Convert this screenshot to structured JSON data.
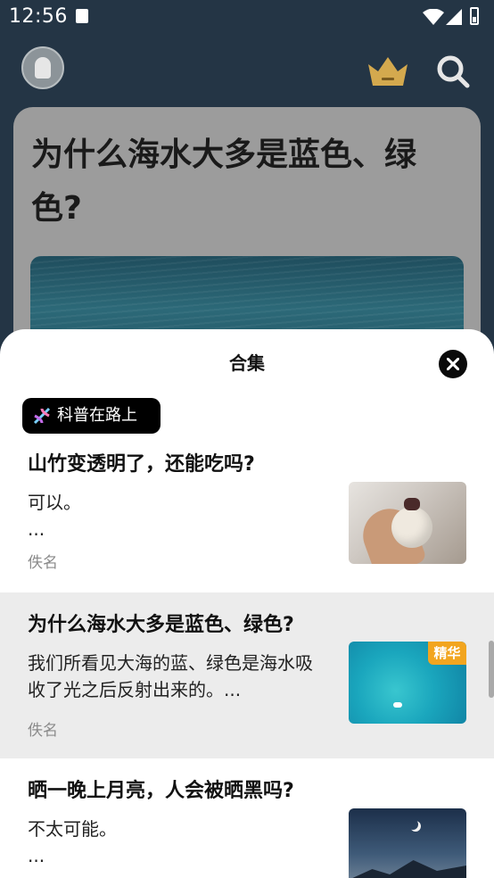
{
  "status_bar": {
    "time": "12:56",
    "icons": [
      "notification-a-icon",
      "wifi-icon",
      "signal-icon",
      "battery-icon"
    ]
  },
  "header": {
    "icons": [
      "avatar",
      "crown-icon",
      "search-icon"
    ],
    "accent": "#d4a94e"
  },
  "background_card": {
    "title": "为什么海水大多是蓝色、绿色?"
  },
  "sheet": {
    "title": "合集",
    "tag": "科普在路上",
    "items": [
      {
        "title": "山竹变透明了，还能吃吗?",
        "excerpt_lines": [
          "可以。",
          "..."
        ],
        "author": "佚名",
        "badge": ""
      },
      {
        "title": "为什么海水大多是蓝色、绿色?",
        "excerpt_lines": [
          "我们所看见大海的蓝、绿色是海水吸",
          "收了光之后反射出来的。..."
        ],
        "author": "佚名",
        "badge": "精华"
      },
      {
        "title": "晒一晚上月亮，人会被晒黑吗?",
        "excerpt_lines": [
          "不太可能。",
          "..."
        ],
        "author": "",
        "badge": ""
      }
    ]
  },
  "colors": {
    "badge": "#f2a51f",
    "highlight_row": "#ececec",
    "tag_bg": "#000000"
  }
}
